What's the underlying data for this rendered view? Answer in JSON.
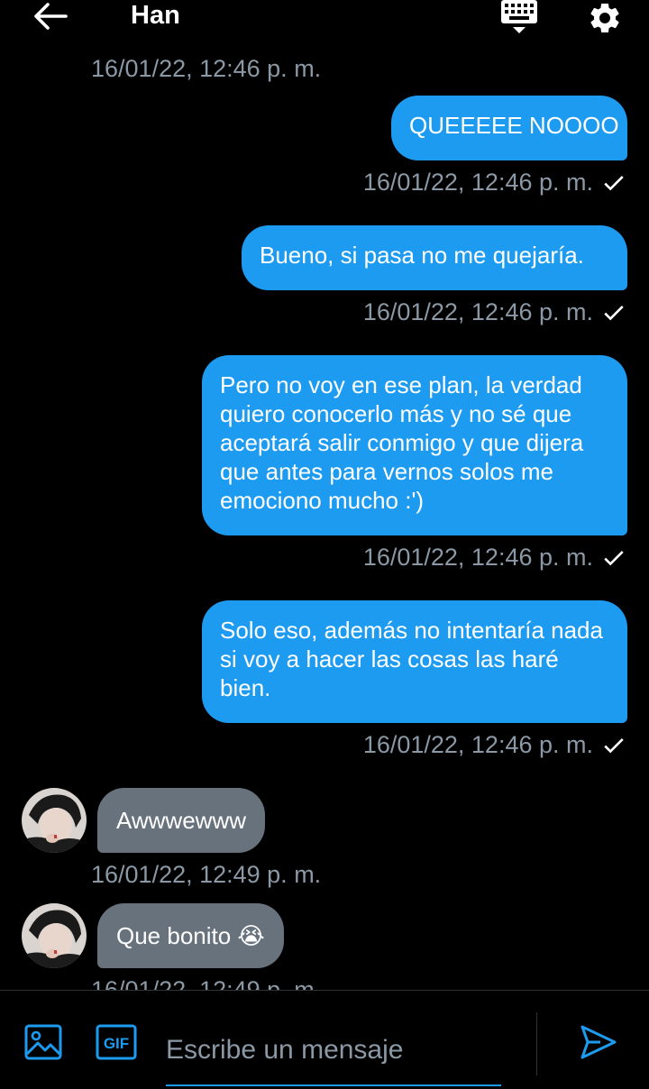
{
  "header": {
    "title": "Han",
    "icons": [
      "arrow-left-icon",
      "keyboard-icon",
      "gear-icon"
    ]
  },
  "messages": [
    {
      "direction": "out",
      "timestamp": "16/01/22, 12:46 p. m.",
      "partial": true
    },
    {
      "direction": "out",
      "text": "QUEEEEE NOOOO",
      "timestamp": "16/01/22, 12:46 p. m.",
      "seen": true
    },
    {
      "direction": "out",
      "text": "Bueno, si pasa no me quejaría.",
      "timestamp": "16/01/22, 12:46 p. m.",
      "seen": true
    },
    {
      "direction": "out",
      "text": "Pero no voy en ese plan, la verdad quiero conocerlo más y no sé que aceptará salir conmigo y que dijera que antes para vernos solos me emociono mucho :')",
      "timestamp": "16/01/22, 12:46 p. m.",
      "seen": true
    },
    {
      "direction": "out",
      "text": "Solo eso, además no intentaría nada si voy a hacer las cosas las haré bien.",
      "timestamp": "16/01/22, 12:46 p. m.",
      "seen": true
    },
    {
      "direction": "in",
      "text": "Awwwewww",
      "timestamp": "16/01/22, 12:49 p. m."
    },
    {
      "direction": "in",
      "text": "Que bonito 😭",
      "timestamp": "16/01/22, 12:49 p. m.",
      "partial": true
    }
  ],
  "composer": {
    "placeholder": "Escribe un mensaje",
    "gif_label": "GIF",
    "icons": [
      "image-icon",
      "gif-icon",
      "send-icon"
    ]
  },
  "colors": {
    "background": "#000000",
    "outgoing_bubble": "#1d9bf0",
    "incoming_bubble": "#68727d",
    "timestamp": "#8b98a5",
    "accent": "#1d9bf0"
  }
}
